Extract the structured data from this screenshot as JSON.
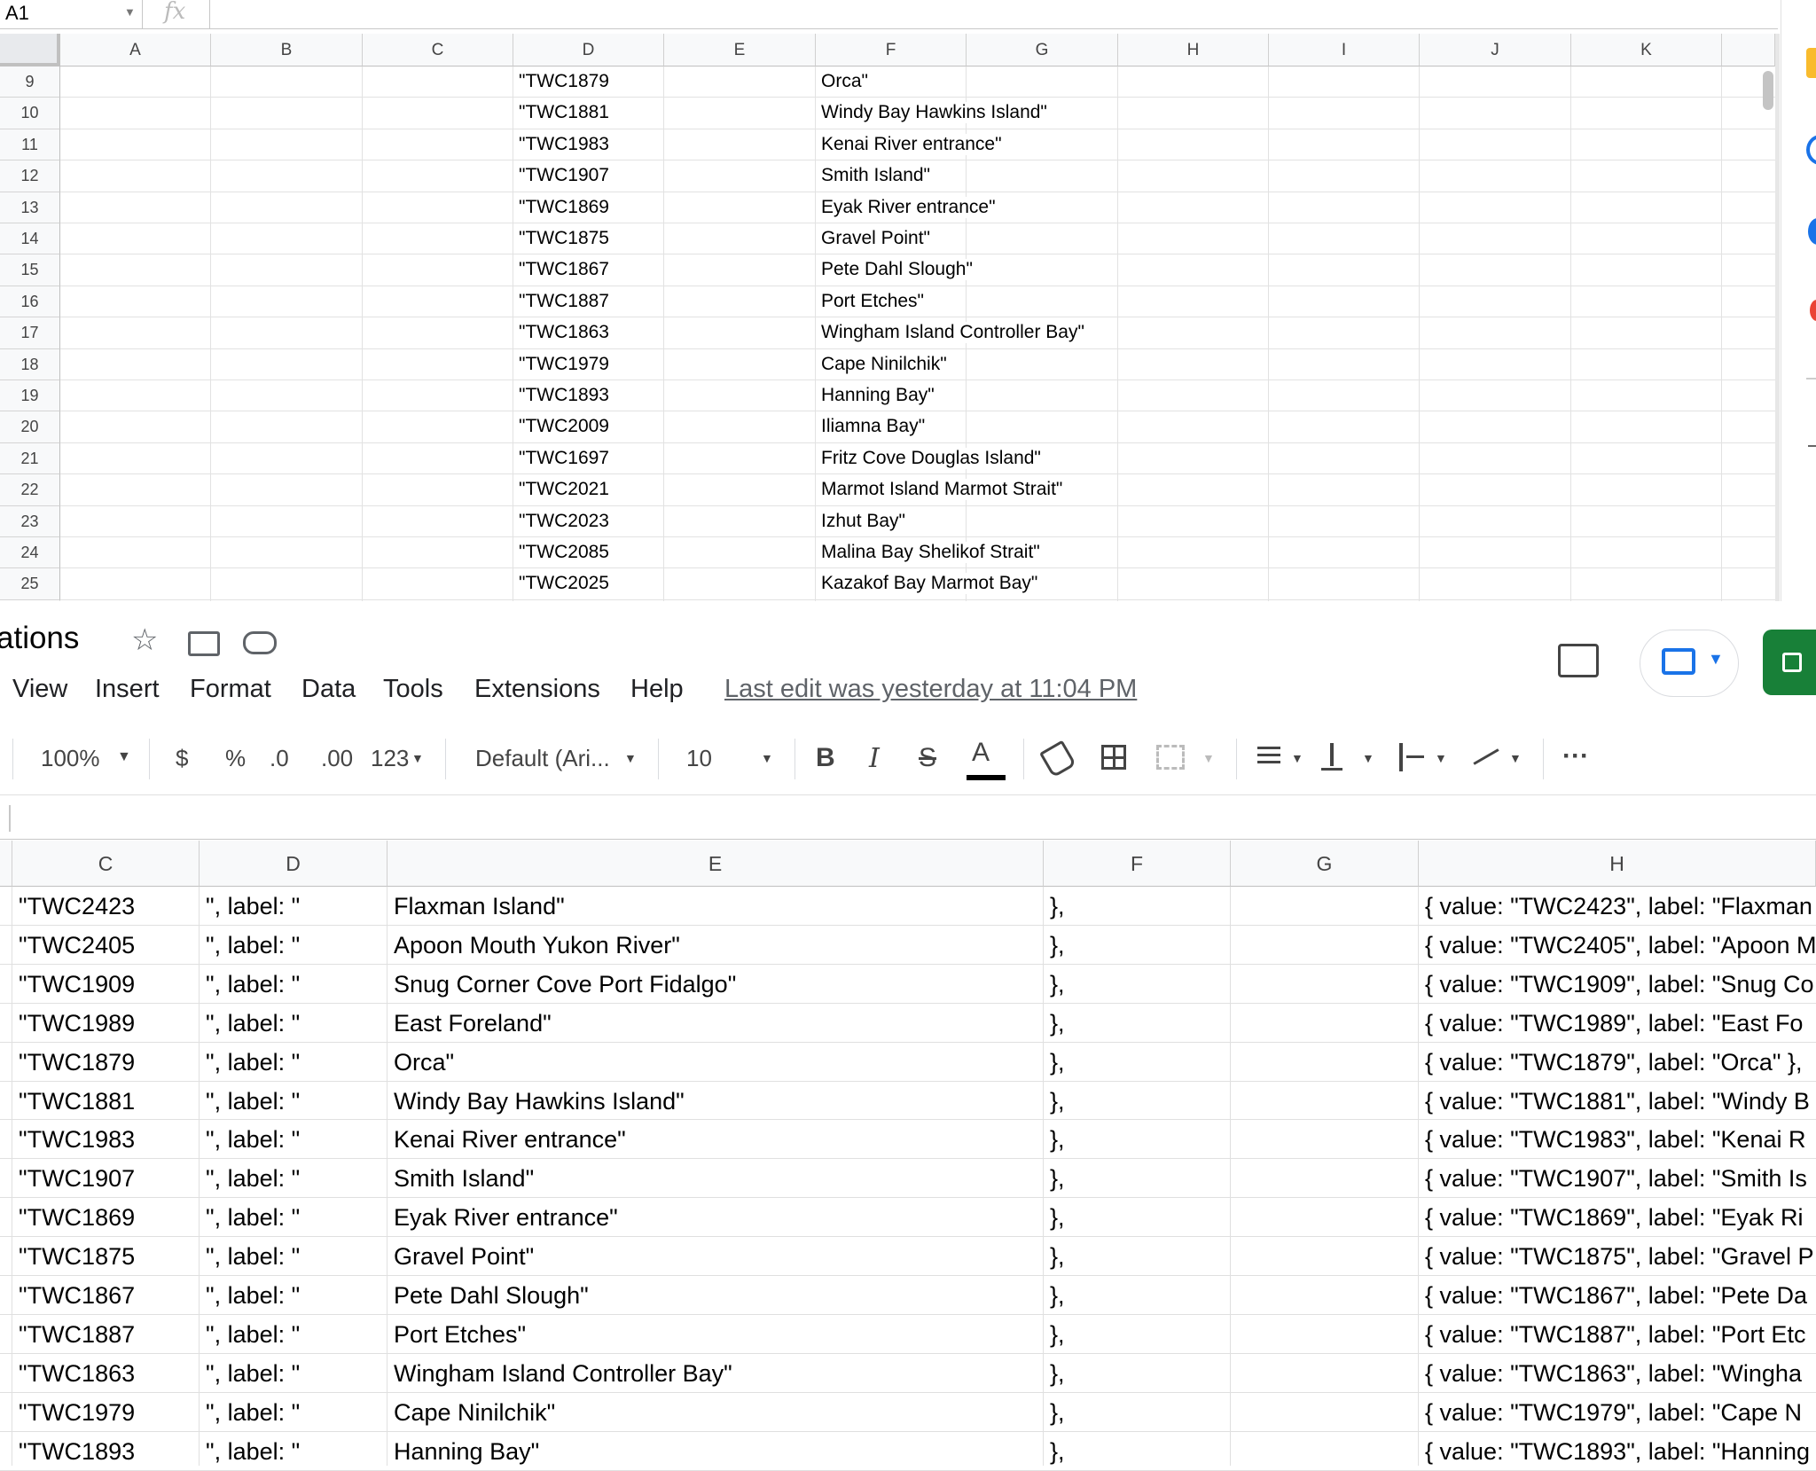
{
  "top_sheet": {
    "name_box": "A1",
    "fx_label": "fx",
    "columns": [
      "A",
      "B",
      "C",
      "D",
      "E",
      "F",
      "G",
      "H",
      "I",
      "J",
      "K"
    ],
    "rows": [
      {
        "num": "9",
        "d": "\"TWC1879",
        "f": "Orca\""
      },
      {
        "num": "10",
        "d": "\"TWC1881",
        "f": "Windy Bay Hawkins Island\""
      },
      {
        "num": "11",
        "d": "\"TWC1983",
        "f": "Kenai River entrance\""
      },
      {
        "num": "12",
        "d": "\"TWC1907",
        "f": "Smith Island\""
      },
      {
        "num": "13",
        "d": "\"TWC1869",
        "f": "Eyak River entrance\""
      },
      {
        "num": "14",
        "d": "\"TWC1875",
        "f": "Gravel Point\""
      },
      {
        "num": "15",
        "d": "\"TWC1867",
        "f": "Pete Dahl Slough\""
      },
      {
        "num": "16",
        "d": "\"TWC1887",
        "f": "Port Etches\""
      },
      {
        "num": "17",
        "d": "\"TWC1863",
        "f": "Wingham Island Controller Bay\""
      },
      {
        "num": "18",
        "d": "\"TWC1979",
        "f": "Cape Ninilchik\""
      },
      {
        "num": "19",
        "d": "\"TWC1893",
        "f": "Hanning Bay\""
      },
      {
        "num": "20",
        "d": "\"TWC2009",
        "f": "Iliamna Bay\""
      },
      {
        "num": "21",
        "d": "\"TWC1697",
        "f": "Fritz Cove Douglas Island\""
      },
      {
        "num": "22",
        "d": "\"TWC2021",
        "f": "Marmot Island Marmot Strait\""
      },
      {
        "num": "23",
        "d": "\"TWC2023",
        "f": "Izhut Bay\""
      },
      {
        "num": "24",
        "d": "\"TWC2085",
        "f": "Malina Bay Shelikof Strait\""
      },
      {
        "num": "25",
        "d": "\"TWC2025",
        "f": "Kazakof Bay Marmot Bay\""
      }
    ]
  },
  "document": {
    "title_fragment": "ations",
    "menu": [
      "View",
      "Insert",
      "Format",
      "Data",
      "Tools",
      "Extensions",
      "Help"
    ],
    "last_edit": "Last edit was yesterday at 11:04 PM"
  },
  "toolbar": {
    "zoom": "100%",
    "currency": "$",
    "percent": "%",
    "decrease_decimal": ".0",
    "increase_decimal": ".00",
    "more_formats": "123",
    "font": "Default (Ari...",
    "font_size": "10",
    "bold": "B",
    "italic": "I",
    "strikethrough": "S",
    "text_color": "A",
    "more": "···"
  },
  "bottom_sheet": {
    "columns": [
      "C",
      "D",
      "E",
      "F",
      "G",
      "H"
    ],
    "rows": [
      {
        "c": "\"TWC2423",
        "d": "\", label: \"",
        "e": "Flaxman Island\"",
        "f": "},",
        "h": "{ value: \"TWC2423\", label: \"Flaxman"
      },
      {
        "c": "\"TWC2405",
        "d": "\", label: \"",
        "e": "Apoon Mouth Yukon River\"",
        "f": "},",
        "h": "{ value: \"TWC2405\", label: \"Apoon M"
      },
      {
        "c": "\"TWC1909",
        "d": "\", label: \"",
        "e": "Snug Corner Cove Port Fidalgo\"",
        "f": "},",
        "h": "{ value: \"TWC1909\", label: \"Snug Co"
      },
      {
        "c": "\"TWC1989",
        "d": "\", label: \"",
        "e": "East Foreland\"",
        "f": "},",
        "h": "{ value: \"TWC1989\", label: \"East Fo"
      },
      {
        "c": "\"TWC1879",
        "d": "\", label: \"",
        "e": "Orca\"",
        "f": "},",
        "h": "{ value: \"TWC1879\", label: \"Orca\" },"
      },
      {
        "c": "\"TWC1881",
        "d": "\", label: \"",
        "e": "Windy Bay Hawkins Island\"",
        "f": "},",
        "h": "{ value: \"TWC1881\", label: \"Windy B"
      },
      {
        "c": "\"TWC1983",
        "d": "\", label: \"",
        "e": "Kenai River entrance\"",
        "f": "},",
        "h": "{ value: \"TWC1983\", label: \"Kenai R"
      },
      {
        "c": "\"TWC1907",
        "d": "\", label: \"",
        "e": "Smith Island\"",
        "f": "},",
        "h": "{ value: \"TWC1907\", label: \"Smith Is"
      },
      {
        "c": "\"TWC1869",
        "d": "\", label: \"",
        "e": "Eyak River entrance\"",
        "f": "},",
        "h": "{ value: \"TWC1869\", label: \"Eyak Ri"
      },
      {
        "c": "\"TWC1875",
        "d": "\", label: \"",
        "e": "Gravel Point\"",
        "f": "},",
        "h": "{ value: \"TWC1875\", label: \"Gravel P"
      },
      {
        "c": "\"TWC1867",
        "d": "\", label: \"",
        "e": "Pete Dahl Slough\"",
        "f": "},",
        "h": "{ value: \"TWC1867\", label: \"Pete Da"
      },
      {
        "c": "\"TWC1887",
        "d": "\", label: \"",
        "e": "Port Etches\"",
        "f": "},",
        "h": "{ value: \"TWC1887\", label: \"Port Etc"
      },
      {
        "c": "\"TWC1863",
        "d": "\", label: \"",
        "e": "Wingham Island Controller Bay\"",
        "f": "},",
        "h": "{ value: \"TWC1863\", label: \"Wingha"
      },
      {
        "c": "\"TWC1979",
        "d": "\", label: \"",
        "e": "Cape Ninilchik\"",
        "f": "},",
        "h": "{ value: \"TWC1979\", label: \"Cape N"
      },
      {
        "c": "\"TWC1893",
        "d": "\", label: \"",
        "e": "Hanning Bay\"",
        "f": "},",
        "h": "{ value: \"TWC1893\", label: \"Hanning"
      }
    ]
  },
  "colors": {
    "accent": "#188038",
    "header_bg": "#f8f9fa",
    "grid": "#e2e2e2",
    "share_blue": "#1a73e8"
  }
}
